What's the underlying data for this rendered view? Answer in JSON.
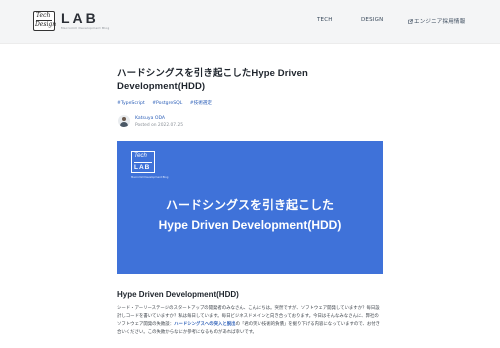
{
  "header": {
    "logo_line1": "Tech",
    "logo_line2": "Design",
    "logo_text": "LAB",
    "logo_sub": "Macromill Development Blog",
    "nav": {
      "tech": "TECH",
      "design": "DESIGN",
      "recruit": "エンジニア採用情報"
    }
  },
  "article": {
    "title": "ハードシングスを引き起こしたHype Driven Development(HDD)",
    "tags": [
      "#TypeScript",
      "#PostgreSQL",
      "#技術選定"
    ],
    "author": "Katsuya ODA",
    "date": "Posted on 2022.07.25"
  },
  "hero": {
    "logo_top": "Tech",
    "logo_bottom": "LAB",
    "sub": "Macromill Development Blog",
    "line1": "ハードシングスを引き起こした",
    "line2": "Hype Driven Development(HDD)"
  },
  "section": {
    "heading": "Hype Driven Development(HDD)",
    "p1": "シード・アーリーステージのスタートアップの開発者のみなさん、こんにちは。突然ですが、ソフトウェア開発していますか？毎日設計しコードを書いていますか？私は毎日しています。毎日ビジネスドメインと向き合っております。今日はそんなみなさんに、弊社のソフトウェア開発の失敗談：",
    "p1_highlight": "ハードシングスへの突入と脱出",
    "p2": "の「君の笑い技術的負債」を掘り下げる内容になっていますので、お付き合いください。この失敗からなにか参考になるものがあれば幸いです。"
  },
  "colors": {
    "accent": "#3f72d9",
    "link": "#2c5fb8",
    "header_bg": "#f4f5f6"
  }
}
